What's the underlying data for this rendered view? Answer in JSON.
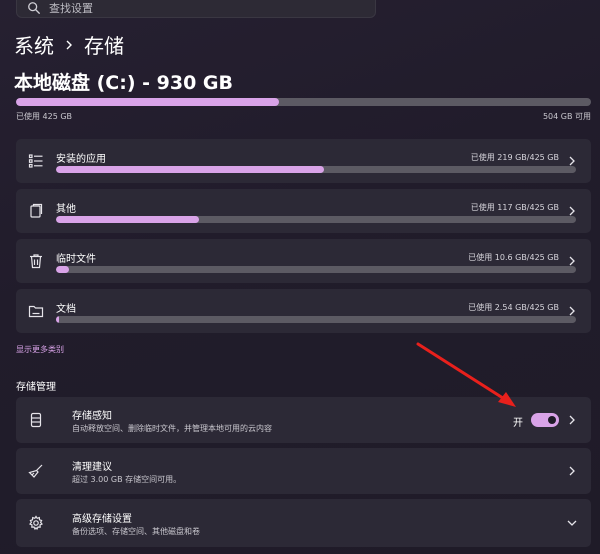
{
  "search": {
    "placeholder": "查找设置"
  },
  "breadcrumb": {
    "parent": "系统",
    "current": "存储"
  },
  "drive": {
    "title": "本地磁盘 (C:) - 930 GB",
    "used_label": "已使用 425 GB",
    "free_label": "504 GB 可用",
    "used_fraction": 0.457
  },
  "categories": [
    {
      "label": "安装的应用",
      "usage": "已使用 219 GB/425 GB",
      "fraction": 0.515,
      "icon": "apps-list-icon"
    },
    {
      "label": "其他",
      "usage": "已使用 117 GB/425 GB",
      "fraction": 0.275,
      "icon": "other-files-icon"
    },
    {
      "label": "临时文件",
      "usage": "已使用 10.6 GB/425 GB",
      "fraction": 0.025,
      "icon": "trash-icon"
    },
    {
      "label": "文档",
      "usage": "已使用 2.54 GB/425 GB",
      "fraction": 0.006,
      "icon": "folder-icon"
    }
  ],
  "more_categories_label": "显示更多类别",
  "management": {
    "title": "存储管理",
    "storage_sense": {
      "title": "存储感知",
      "desc": "自动释放空间、删除临时文件，并管理本地可用的云内容",
      "toggle_label": "开",
      "toggle_on": true,
      "icon": "storage-drive-icon"
    },
    "cleanup": {
      "title": "清理建议",
      "desc": "超过 3.00 GB 存储空间可用。",
      "icon": "broom-icon"
    },
    "advanced": {
      "title": "高级存储设置",
      "desc": "备份选项、存储空间、其他磁盘和卷",
      "icon": "gear-icon"
    }
  },
  "colors": {
    "accent": "#d9a3e8",
    "card": "#2c2936",
    "track": "#5c5a63",
    "annotation_arrow": "#e8201c"
  }
}
